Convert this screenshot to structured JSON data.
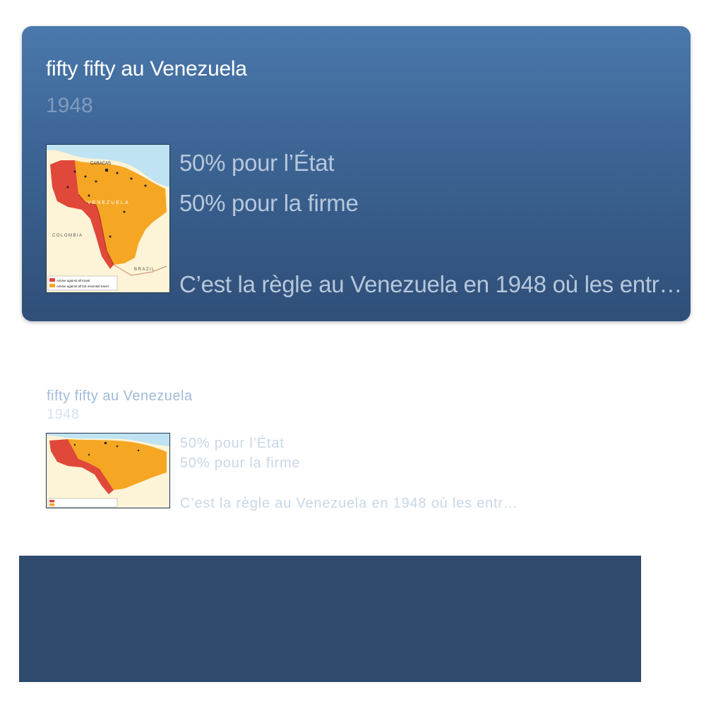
{
  "card": {
    "title": "fifty fifty au Venezuela",
    "year": "1948",
    "lines": [
      "50% pour l’État",
      "50% pour la firme",
      "C’est la règle au Venezuela en 1948 où les entr…"
    ],
    "map": {
      "labels": [
        "CARACAS",
        "VENEZUELA",
        "COLOMBIA",
        "BRAZIL"
      ],
      "legend": [
        "Advise against all travel",
        "Advise against all but essential travel"
      ],
      "colors": {
        "red_zone": "#e0483a",
        "orange_zone": "#f5a623",
        "sea": "#bfe3f2",
        "land": "#fdf3d6"
      }
    }
  },
  "preview": {
    "title": "fifty fifty au Venezuela",
    "year": "1948",
    "lines": [
      "50% pour l’État",
      "50% pour la firme",
      "C’est la règle au Venezuela en 1948 où les entr…"
    ]
  },
  "colors": {
    "card_top": "#4a78ac",
    "card_bottom": "#2f4f78",
    "bottom_block": "#2e4b6d"
  }
}
